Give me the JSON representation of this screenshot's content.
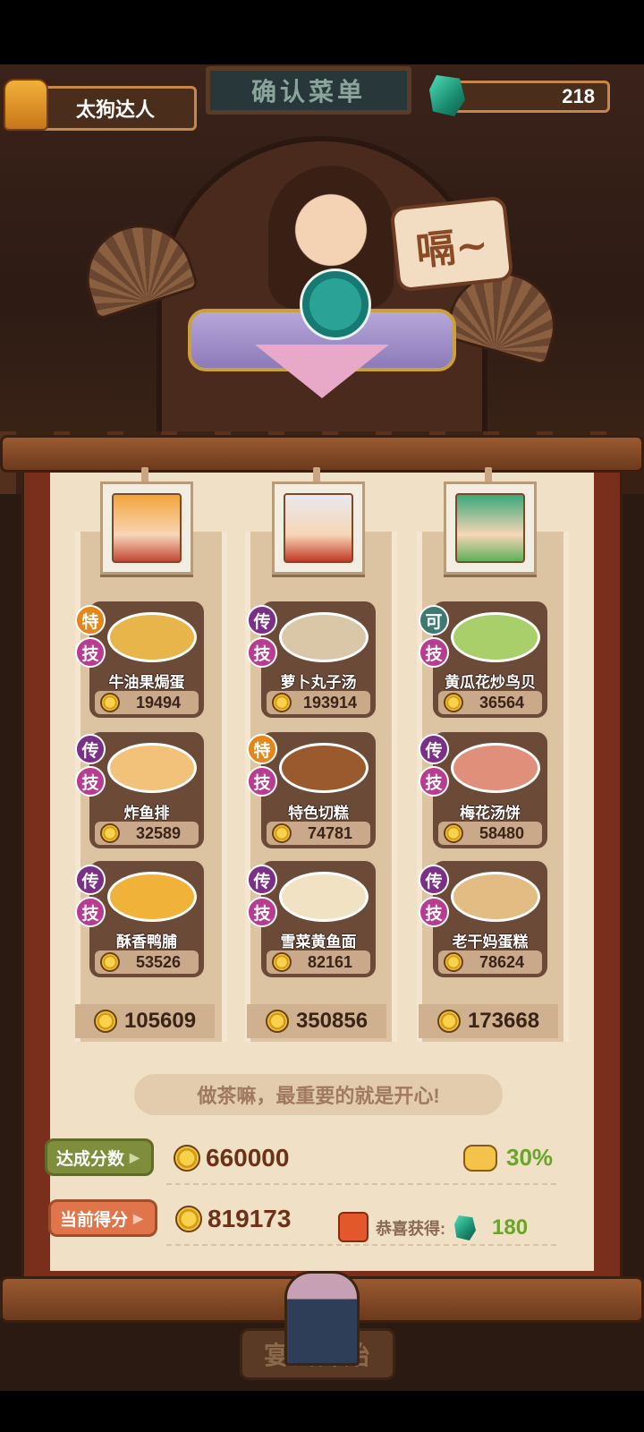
{
  "header": {
    "player_name": "太狗达人",
    "title": "确认菜单",
    "gems": "218"
  },
  "scene": {
    "speech_text": "嗝~"
  },
  "columns": [
    {
      "dishes": [
        {
          "badge1": "特",
          "badge2": "技",
          "name": "牛油果焗蛋",
          "score": "19494",
          "food_color": "#e7b54a"
        },
        {
          "badge1": "传",
          "badge2": "技",
          "name": "炸鱼排",
          "score": "32589",
          "food_color": "#f3c27a"
        },
        {
          "badge1": "传",
          "badge2": "技",
          "name": "酥香鸭脯",
          "score": "53526",
          "food_color": "#f1b23a"
        }
      ],
      "total": "105609"
    },
    {
      "dishes": [
        {
          "badge1": "传",
          "badge2": "技",
          "name": "萝卜丸子汤",
          "score": "193914",
          "food_color": "#d9c7a8"
        },
        {
          "badge1": "特",
          "badge2": "技",
          "name": "特色切糕",
          "score": "74781",
          "food_color": "#9a5a2e"
        },
        {
          "badge1": "传",
          "badge2": "技",
          "name": "雪菜黄鱼面",
          "score": "82161",
          "food_color": "#f2e2c4"
        }
      ],
      "total": "350856"
    },
    {
      "dishes": [
        {
          "badge1": "可",
          "badge2": "技",
          "name": "黄瓜花炒鸟贝",
          "score": "36564",
          "food_color": "#a8cf6a"
        },
        {
          "badge1": "传",
          "badge2": "技",
          "name": "梅花汤饼",
          "score": "58480",
          "food_color": "#e0907a"
        },
        {
          "badge1": "传",
          "badge2": "技",
          "name": "老干妈蛋糕",
          "score": "78624",
          "food_color": "#e2bc82"
        }
      ],
      "total": "173668"
    }
  ],
  "slogan": "做茶嘛，最重要的就是开心!",
  "target": {
    "label": "达成分数",
    "score": "660000",
    "bonus_pct": "30%"
  },
  "current": {
    "label": "当前得分",
    "score": "819173",
    "reward_label": "恭喜获得:",
    "reward_value": "180"
  },
  "start_button": "宴会开始",
  "colors": {
    "accent_green": "#6aa52a",
    "score_brown": "#6b3218"
  }
}
